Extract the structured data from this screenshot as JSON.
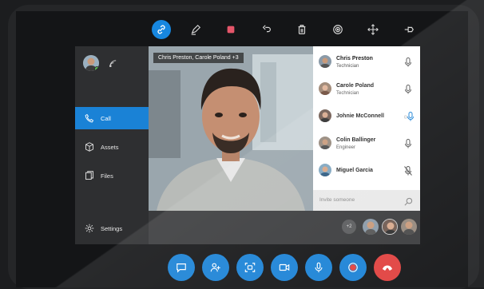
{
  "toolbar": {
    "tools": [
      "link-icon",
      "pen-icon",
      "stop-icon",
      "undo-icon",
      "trash-icon",
      "target-icon",
      "move-icon",
      "pin-icon"
    ],
    "active_tool": "link-icon",
    "accent": "#1787e0"
  },
  "sidebar": {
    "items": [
      {
        "label": "Call",
        "icon": "phone-icon",
        "active": true
      },
      {
        "label": "Assets",
        "icon": "box-icon",
        "active": false
      },
      {
        "label": "Files",
        "icon": "files-icon",
        "active": false
      },
      {
        "label": "Settings",
        "icon": "gear-icon",
        "active": false
      }
    ]
  },
  "video": {
    "caption": "Chris Preston, Carole Poland +3"
  },
  "participants": [
    {
      "name": "Chris Preston",
      "role": "Technician",
      "mic": "on"
    },
    {
      "name": "Carole Poland",
      "role": "Technician",
      "mic": "on"
    },
    {
      "name": "Johnie McConnell",
      "role": "",
      "mic": "active"
    },
    {
      "name": "Colin Ballinger",
      "role": "Engineer",
      "mic": "on"
    },
    {
      "name": "Miguel Garcia",
      "role": "",
      "mic": "muted"
    }
  ],
  "invite": {
    "placeholder": "Invite someone"
  },
  "strip": {
    "more_label": "+2"
  },
  "call_controls": {
    "buttons": [
      "chat-icon",
      "add-people-icon",
      "screenshot-icon",
      "video-icon",
      "mic-icon",
      "record-icon",
      "end-call-icon"
    ],
    "primary_color": "#1a82d6",
    "end_color": "#e0413f"
  }
}
